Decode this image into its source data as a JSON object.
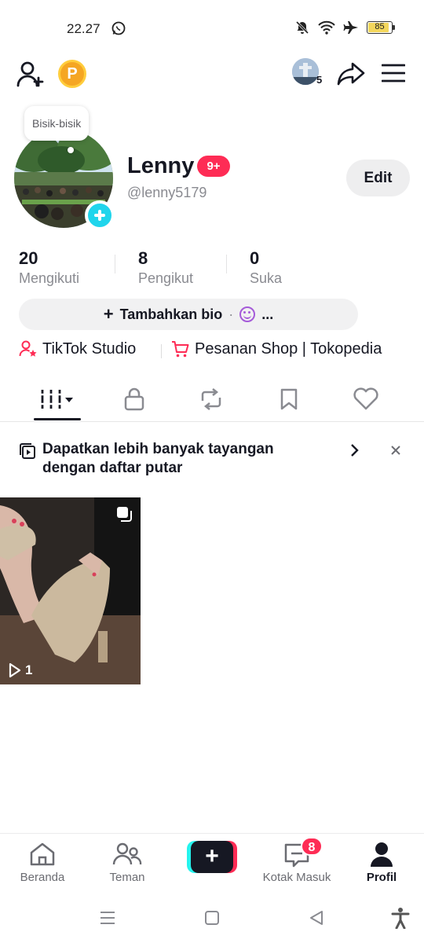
{
  "status_bar": {
    "time": "22.27",
    "battery": "85"
  },
  "profile": {
    "bubble_text": "Bisik-bisik",
    "display_name": "Lenny",
    "notification_badge": "9+",
    "username": "@lenny5179",
    "edit_label": "Edit",
    "story_count": "5"
  },
  "stats": [
    {
      "value": "20",
      "label": "Mengikuti"
    },
    {
      "value": "8",
      "label": "Pengikut"
    },
    {
      "value": "0",
      "label": "Suka"
    }
  ],
  "bio": {
    "add_label": "Tambahkan bio",
    "ellipsis": "..."
  },
  "links": {
    "studio": "TikTok Studio",
    "shop": "Pesanan Shop | Tokopedia"
  },
  "banner": {
    "text": "Dapatkan lebih banyak tayangan dengan daftar putar"
  },
  "video": {
    "views": "1"
  },
  "bottom_nav": {
    "home": "Beranda",
    "friends": "Teman",
    "create": "+",
    "inbox": "Kotak Masuk",
    "inbox_badge": "8",
    "profile": "Profil"
  },
  "icons": {
    "add_user": "add-user-icon",
    "coin": "P",
    "share": "share-icon",
    "menu": "menu-icon"
  },
  "colors": {
    "accent": "#fe2c55",
    "cyan": "#25f4ee",
    "add_avatar": "#20d5ec",
    "coin": "#f5a623"
  }
}
